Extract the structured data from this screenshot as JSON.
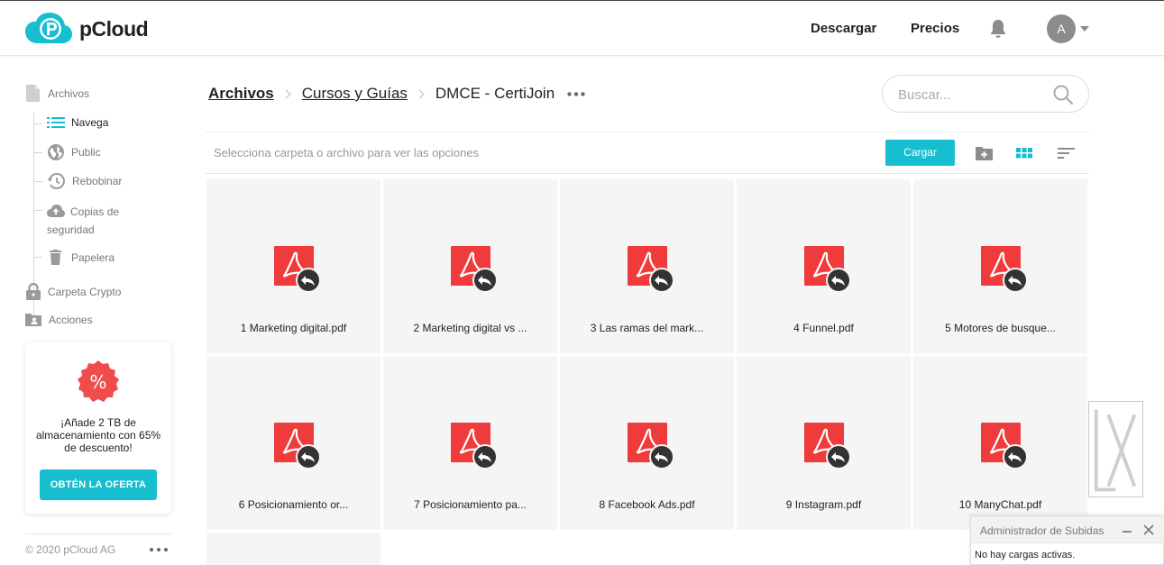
{
  "brand": {
    "name": "pCloud",
    "accent": "#17bed0"
  },
  "header": {
    "download_label": "Descargar",
    "pricing_label": "Precios",
    "avatar_initial": "A"
  },
  "sidebar": {
    "items": [
      {
        "label": "Archivos",
        "icon": "file-icon"
      },
      {
        "label": "Navega",
        "icon": "list-icon"
      },
      {
        "label": "Public",
        "icon": "globe-icon"
      },
      {
        "label": "Rebobinar",
        "icon": "history-icon"
      },
      {
        "label": "Copias de",
        "label2": "seguridad",
        "icon": "cloud-upload-icon"
      },
      {
        "label": "Papelera",
        "icon": "trash-icon"
      },
      {
        "label": "Carpeta Crypto",
        "icon": "lock-icon"
      },
      {
        "label": "Acciones",
        "icon": "shared-folder-icon"
      }
    ],
    "promo": {
      "badge": "%",
      "text": "¡Añade 2 TB de almacenamiento con 65% de descuento!",
      "button": "OBTÉN LA OFERTA"
    },
    "copyright": "© 2020 pCloud AG"
  },
  "breadcrumb": {
    "root": "Archivos",
    "parent": "Cursos y Guías",
    "current": "DMCE - CertiJoin"
  },
  "search": {
    "placeholder": "Buscar..."
  },
  "toolbar": {
    "hint": "Selecciona carpeta o archivo para ver las opciones",
    "upload_label": "Cargar"
  },
  "files": [
    "1 Marketing digital.pdf",
    "2 Marketing digital vs ...",
    "3 Las ramas del mark...",
    "4 Funnel.pdf",
    "5 Motores de busque...",
    "6 Posicionamiento or...",
    "7 Posicionamiento pa...",
    "8 Facebook Ads.pdf",
    "9 Instagram.pdf",
    "10 ManyChat.pdf"
  ],
  "upload_manager": {
    "title": "Administrador de Subidas",
    "status": "No hay cargas activas."
  },
  "colors": {
    "pdf_red": "#ef3b3b",
    "tile_bg": "#f5f5f5"
  }
}
